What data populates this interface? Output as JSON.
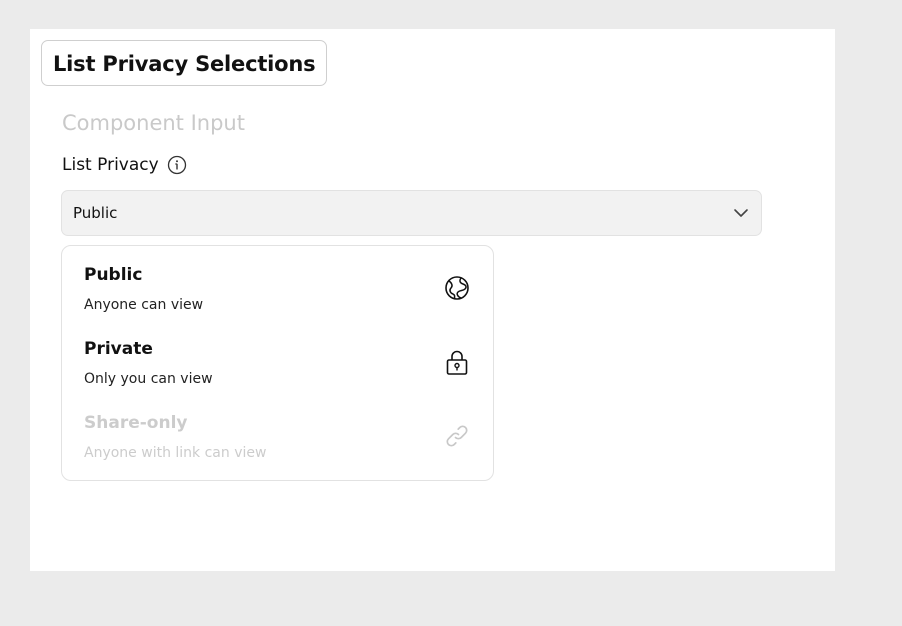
{
  "header": {
    "title": "List Privacy Selections"
  },
  "section": {
    "heading": "Component Input"
  },
  "field": {
    "label": "List Privacy",
    "info_icon": "info-circle-icon"
  },
  "select": {
    "value": "Public",
    "expanded": true,
    "chevron_icon": "chevron-down-icon"
  },
  "options": [
    {
      "title": "Public",
      "description": "Anyone can view",
      "icon": "globe-icon",
      "disabled": false
    },
    {
      "title": "Private",
      "description": "Only you can view",
      "icon": "lock-icon",
      "disabled": false
    },
    {
      "title": "Share-only",
      "description": "Anyone with link can view",
      "icon": "link-icon",
      "disabled": true
    }
  ],
  "colors": {
    "background": "#ebebeb",
    "panel": "#ffffff",
    "select_bg": "#f2f2f2",
    "disabled_text": "#cccccc",
    "muted_heading": "#c9c9c9"
  }
}
